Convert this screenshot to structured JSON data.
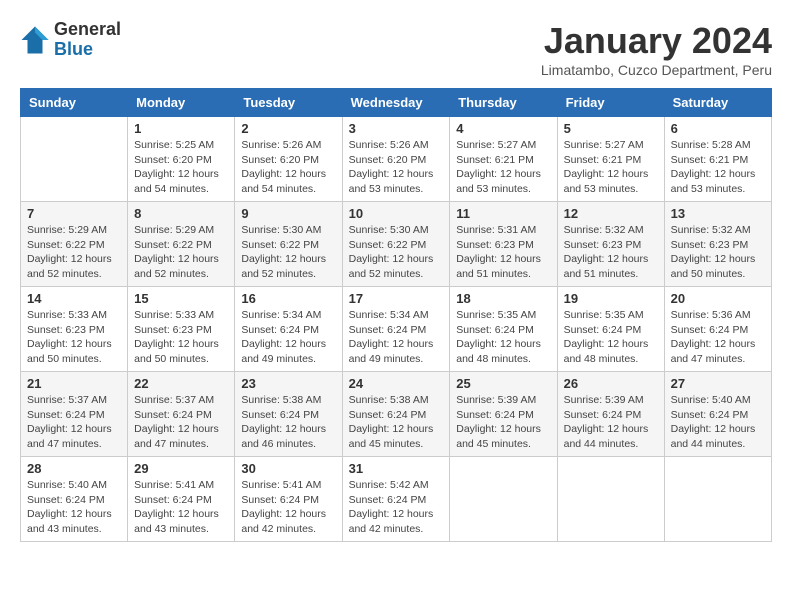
{
  "logo": {
    "general": "General",
    "blue": "Blue"
  },
  "title": "January 2024",
  "location": "Limatambo, Cuzco Department, Peru",
  "days_of_week": [
    "Sunday",
    "Monday",
    "Tuesday",
    "Wednesday",
    "Thursday",
    "Friday",
    "Saturday"
  ],
  "weeks": [
    [
      {
        "day": "",
        "info": ""
      },
      {
        "day": "1",
        "info": "Sunrise: 5:25 AM\nSunset: 6:20 PM\nDaylight: 12 hours\nand 54 minutes."
      },
      {
        "day": "2",
        "info": "Sunrise: 5:26 AM\nSunset: 6:20 PM\nDaylight: 12 hours\nand 54 minutes."
      },
      {
        "day": "3",
        "info": "Sunrise: 5:26 AM\nSunset: 6:20 PM\nDaylight: 12 hours\nand 53 minutes."
      },
      {
        "day": "4",
        "info": "Sunrise: 5:27 AM\nSunset: 6:21 PM\nDaylight: 12 hours\nand 53 minutes."
      },
      {
        "day": "5",
        "info": "Sunrise: 5:27 AM\nSunset: 6:21 PM\nDaylight: 12 hours\nand 53 minutes."
      },
      {
        "day": "6",
        "info": "Sunrise: 5:28 AM\nSunset: 6:21 PM\nDaylight: 12 hours\nand 53 minutes."
      }
    ],
    [
      {
        "day": "7",
        "info": "Sunrise: 5:29 AM\nSunset: 6:22 PM\nDaylight: 12 hours\nand 52 minutes."
      },
      {
        "day": "8",
        "info": "Sunrise: 5:29 AM\nSunset: 6:22 PM\nDaylight: 12 hours\nand 52 minutes."
      },
      {
        "day": "9",
        "info": "Sunrise: 5:30 AM\nSunset: 6:22 PM\nDaylight: 12 hours\nand 52 minutes."
      },
      {
        "day": "10",
        "info": "Sunrise: 5:30 AM\nSunset: 6:22 PM\nDaylight: 12 hours\nand 52 minutes."
      },
      {
        "day": "11",
        "info": "Sunrise: 5:31 AM\nSunset: 6:23 PM\nDaylight: 12 hours\nand 51 minutes."
      },
      {
        "day": "12",
        "info": "Sunrise: 5:32 AM\nSunset: 6:23 PM\nDaylight: 12 hours\nand 51 minutes."
      },
      {
        "day": "13",
        "info": "Sunrise: 5:32 AM\nSunset: 6:23 PM\nDaylight: 12 hours\nand 50 minutes."
      }
    ],
    [
      {
        "day": "14",
        "info": "Sunrise: 5:33 AM\nSunset: 6:23 PM\nDaylight: 12 hours\nand 50 minutes."
      },
      {
        "day": "15",
        "info": "Sunrise: 5:33 AM\nSunset: 6:23 PM\nDaylight: 12 hours\nand 50 minutes."
      },
      {
        "day": "16",
        "info": "Sunrise: 5:34 AM\nSunset: 6:24 PM\nDaylight: 12 hours\nand 49 minutes."
      },
      {
        "day": "17",
        "info": "Sunrise: 5:34 AM\nSunset: 6:24 PM\nDaylight: 12 hours\nand 49 minutes."
      },
      {
        "day": "18",
        "info": "Sunrise: 5:35 AM\nSunset: 6:24 PM\nDaylight: 12 hours\nand 48 minutes."
      },
      {
        "day": "19",
        "info": "Sunrise: 5:35 AM\nSunset: 6:24 PM\nDaylight: 12 hours\nand 48 minutes."
      },
      {
        "day": "20",
        "info": "Sunrise: 5:36 AM\nSunset: 6:24 PM\nDaylight: 12 hours\nand 47 minutes."
      }
    ],
    [
      {
        "day": "21",
        "info": "Sunrise: 5:37 AM\nSunset: 6:24 PM\nDaylight: 12 hours\nand 47 minutes."
      },
      {
        "day": "22",
        "info": "Sunrise: 5:37 AM\nSunset: 6:24 PM\nDaylight: 12 hours\nand 47 minutes."
      },
      {
        "day": "23",
        "info": "Sunrise: 5:38 AM\nSunset: 6:24 PM\nDaylight: 12 hours\nand 46 minutes."
      },
      {
        "day": "24",
        "info": "Sunrise: 5:38 AM\nSunset: 6:24 PM\nDaylight: 12 hours\nand 45 minutes."
      },
      {
        "day": "25",
        "info": "Sunrise: 5:39 AM\nSunset: 6:24 PM\nDaylight: 12 hours\nand 45 minutes."
      },
      {
        "day": "26",
        "info": "Sunrise: 5:39 AM\nSunset: 6:24 PM\nDaylight: 12 hours\nand 44 minutes."
      },
      {
        "day": "27",
        "info": "Sunrise: 5:40 AM\nSunset: 6:24 PM\nDaylight: 12 hours\nand 44 minutes."
      }
    ],
    [
      {
        "day": "28",
        "info": "Sunrise: 5:40 AM\nSunset: 6:24 PM\nDaylight: 12 hours\nand 43 minutes."
      },
      {
        "day": "29",
        "info": "Sunrise: 5:41 AM\nSunset: 6:24 PM\nDaylight: 12 hours\nand 43 minutes."
      },
      {
        "day": "30",
        "info": "Sunrise: 5:41 AM\nSunset: 6:24 PM\nDaylight: 12 hours\nand 42 minutes."
      },
      {
        "day": "31",
        "info": "Sunrise: 5:42 AM\nSunset: 6:24 PM\nDaylight: 12 hours\nand 42 minutes."
      },
      {
        "day": "",
        "info": ""
      },
      {
        "day": "",
        "info": ""
      },
      {
        "day": "",
        "info": ""
      }
    ]
  ]
}
